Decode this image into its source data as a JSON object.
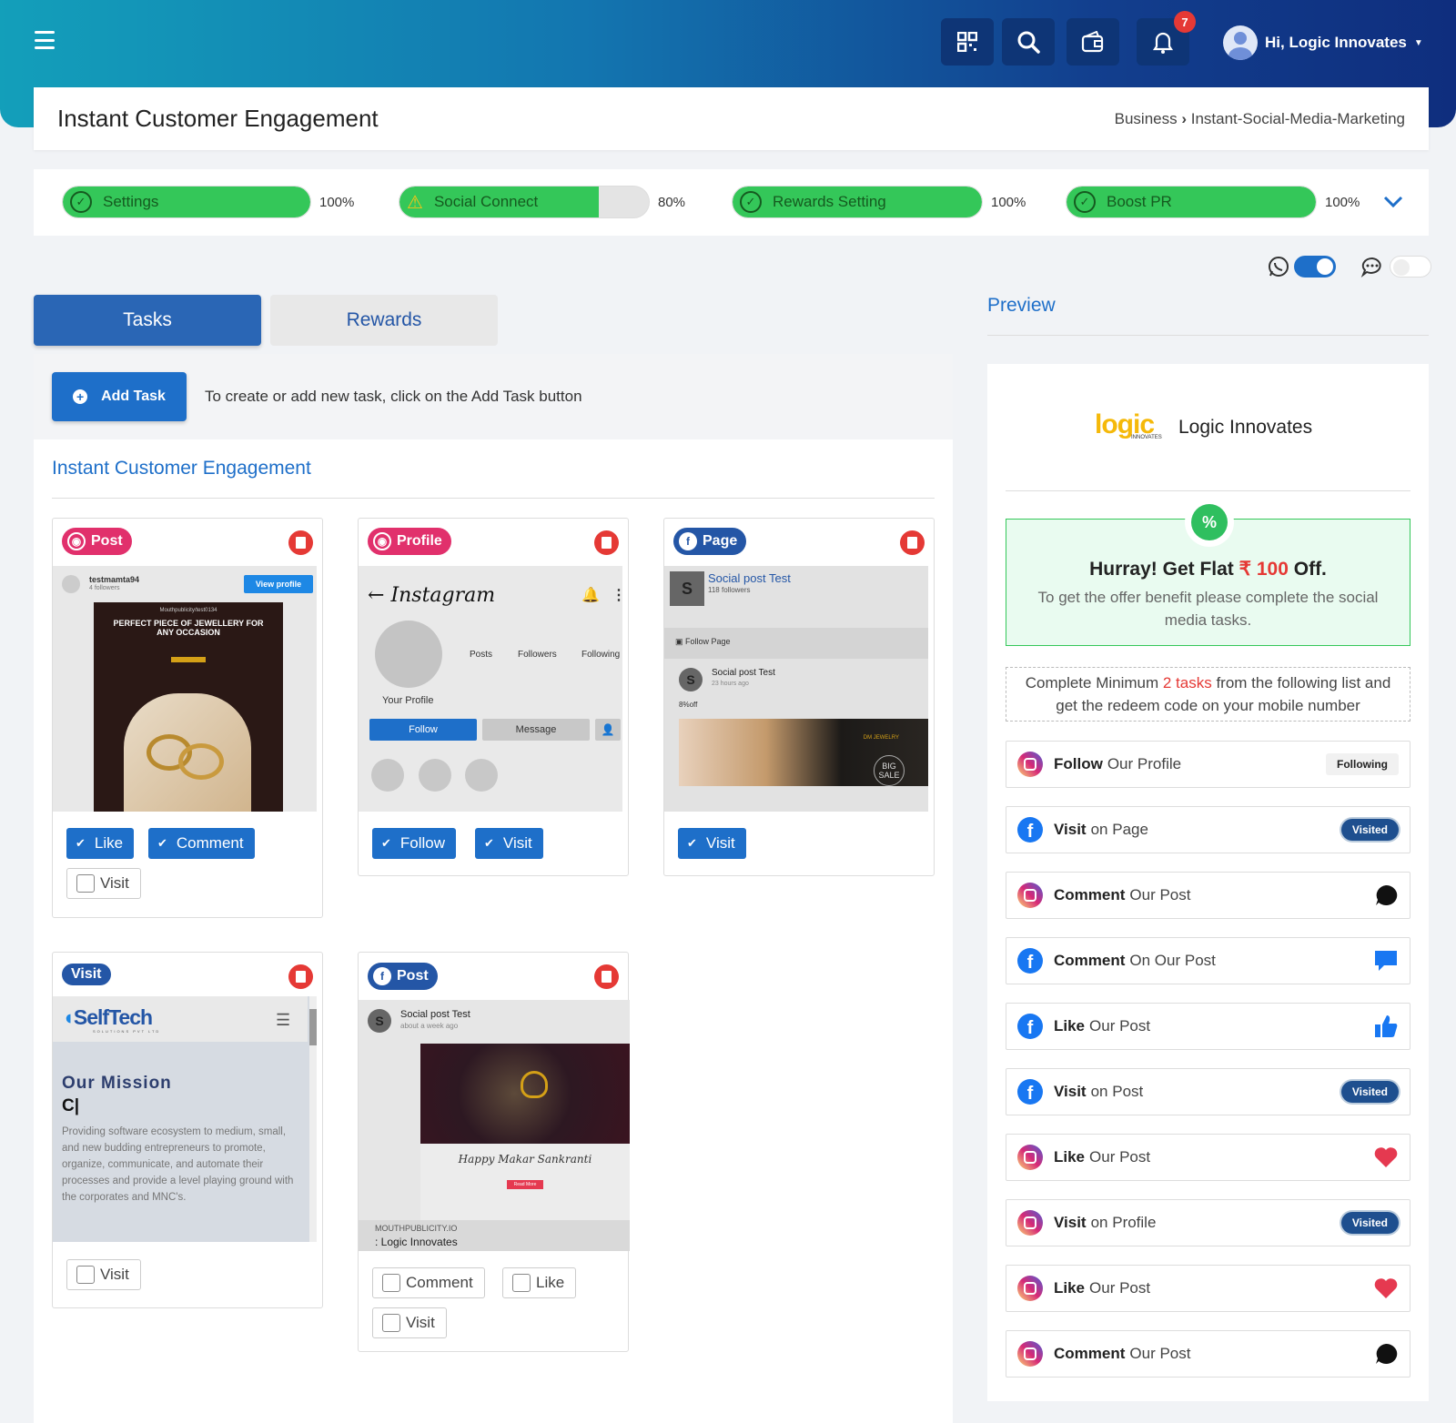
{
  "header": {
    "user_greeting": "Hi, Logic Innovates",
    "notification_count": "7"
  },
  "page": {
    "title": "Instant Customer Engagement",
    "breadcrumb_parent": "Business",
    "breadcrumb_current": "Instant-Social-Media-Marketing"
  },
  "progress": [
    {
      "label": "Settings",
      "percent_text": "100%",
      "value": 100,
      "status": "complete"
    },
    {
      "label": "Social Connect",
      "percent_text": "80%",
      "value": 80,
      "status": "warning"
    },
    {
      "label": "Rewards Setting",
      "percent_text": "100%",
      "value": 100,
      "status": "complete"
    },
    {
      "label": "Boost PR",
      "percent_text": "100%",
      "value": 100,
      "status": "complete"
    }
  ],
  "toggles": {
    "whatsapp_on": true,
    "sms_on": false
  },
  "tabs": {
    "tasks": "Tasks",
    "rewards": "Rewards"
  },
  "add": {
    "button": "Add Task",
    "hint": "To create or add new task, click on the Add Task button"
  },
  "section_title": "Instant Customer Engagement",
  "cards": {
    "c1": {
      "chip": "Post",
      "username": "testmamta94",
      "followers": "4 followers",
      "view_profile": "View profile",
      "handle": "Mouthpublicity/test0134",
      "headline": "PERFECT PIECE OF JEWELLERY FOR ANY OCCASION",
      "opt_like": "Like",
      "opt_comment": "Comment",
      "opt_visit": "Visit"
    },
    "c2": {
      "chip": "Profile",
      "logo": "Instagram",
      "posts": "Posts",
      "followers": "Followers",
      "following": "Following",
      "your_profile": "Your Profile",
      "follow_btn": "Follow",
      "message_btn": "Message",
      "opt_follow": "Follow",
      "opt_visit": "Visit"
    },
    "c3": {
      "chip": "Page",
      "page_name": "Social post Test",
      "page_followers": "118 followers",
      "follow_page": "Follow Page",
      "post_name": "Social post Test",
      "post_time": "23 hours ago",
      "post_text": "8%off",
      "brand": "DM JEWELRY",
      "sale": "BIG SALE",
      "opt_visit": "Visit"
    },
    "c4": {
      "chip": "Visit",
      "brand": "SelfTech",
      "brand_sub": "SOLUTIONS PVT LTD",
      "mission_title": "Our Mission",
      "mission_cursor": "C|",
      "mission_text": "Providing software ecosystem to medium, small, and new budding entrepreneurs to promote, organize, communicate, and automate their processes and provide a level playing ground with the corporates and MNC's.",
      "opt_visit": "Visit"
    },
    "c5": {
      "chip": "Post",
      "post_name": "Social post Test",
      "post_time": "about a week ago",
      "festival": "Happy Makar Sankranti",
      "read_more": "Read More",
      "site": "MOUTHPUBLICITY.IO",
      "site_name": ": Logic Innovates",
      "opt_comment": "Comment",
      "opt_like": "Like",
      "opt_visit": "Visit"
    }
  },
  "preview": {
    "heading": "Preview",
    "brand_logo": "logic",
    "brand_logo_sub": "INNOVATES",
    "brand_name": "Logic Innovates",
    "offer_prefix": "Hurray! Get Flat ",
    "offer_currency": "₹",
    "offer_amount": "100",
    "offer_suffix": " Off.",
    "offer_sub": "To get the offer benefit please complete the social media tasks.",
    "min_prefix": "Complete Minimum ",
    "min_count": "2 tasks",
    "min_suffix": " from the following list and get the redeem code on your mobile number",
    "tasks": [
      {
        "platform": "instagram",
        "action": "Follow",
        "object": "Our Profile",
        "badge": "Following",
        "badge_type": "following"
      },
      {
        "platform": "facebook",
        "action": "Visit",
        "object": "on Page",
        "badge": "Visited",
        "badge_type": "visited"
      },
      {
        "platform": "instagram",
        "action": "Comment",
        "object": "Our Post",
        "icon": "comment-bubble-black-icon"
      },
      {
        "platform": "facebook",
        "action": "Comment",
        "object": "On Our Post",
        "icon": "comment-bubble-blue-icon"
      },
      {
        "platform": "facebook",
        "action": "Like",
        "object": "Our Post",
        "icon": "thumbs-up-icon"
      },
      {
        "platform": "facebook",
        "action": "Visit",
        "object": "on Post",
        "badge": "Visited",
        "badge_type": "visited"
      },
      {
        "platform": "instagram",
        "action": "Like",
        "object": "Our Post",
        "icon": "heart-icon"
      },
      {
        "platform": "instagram",
        "action": "Visit",
        "object": "on Profile",
        "badge": "Visited",
        "badge_type": "visited"
      },
      {
        "platform": "instagram",
        "action": "Like",
        "object": "Our Post",
        "icon": "heart-icon"
      },
      {
        "platform": "instagram",
        "action": "Comment",
        "object": "Our Post",
        "icon": "comment-bubble-black-icon"
      }
    ]
  },
  "colors": {
    "primary": "#1e6fc9",
    "success": "#34c759",
    "danger": "#e53935",
    "instagram_chip": "#e1306c",
    "facebook_chip": "#2456a6"
  }
}
